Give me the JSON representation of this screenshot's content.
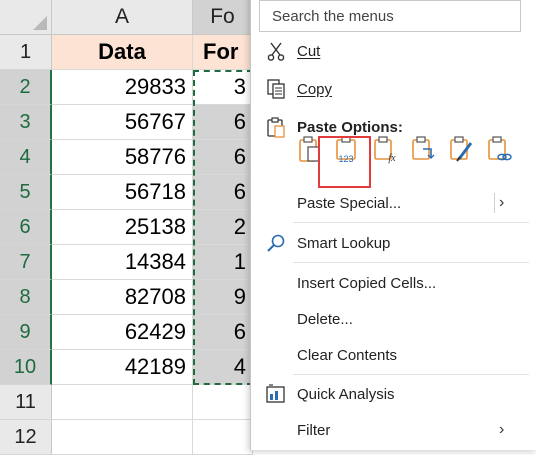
{
  "sheet": {
    "columns": [
      "A",
      "Fo"
    ],
    "rows": [
      "1",
      "2",
      "3",
      "4",
      "5",
      "6",
      "7",
      "8",
      "9",
      "10",
      "11",
      "12"
    ],
    "header_a": "Data",
    "header_b": "For",
    "data_values": [
      "29833",
      "56767",
      "58776",
      "56718",
      "25138",
      "14384",
      "82708",
      "62429",
      "42189"
    ],
    "b_values": [
      "3",
      "6",
      "6",
      "6",
      "2",
      "1",
      "9",
      "6",
      "4"
    ]
  },
  "menu": {
    "search_placeholder": "Search the menus",
    "cut": "Cut",
    "copy": "Copy",
    "paste_options": "Paste Options:",
    "paste_special": "Paste Special...",
    "smart_lookup": "Smart Lookup",
    "insert_copied_cells": "Insert Copied Cells...",
    "delete": "Delete...",
    "clear_contents": "Clear Contents",
    "quick_analysis": "Quick Analysis",
    "filter": "Filter",
    "submenu_arrow": "›",
    "paste_values_badge": "123",
    "paste_formula_badge": "fx"
  },
  "colors": {
    "header_fill": "#fde3d3",
    "selected_fill": "#d3d3d3",
    "excel_green": "#217346",
    "highlight_red": "#e23b3b",
    "icon_orange": "#e8913a",
    "icon_blue": "#2b6cb0"
  }
}
